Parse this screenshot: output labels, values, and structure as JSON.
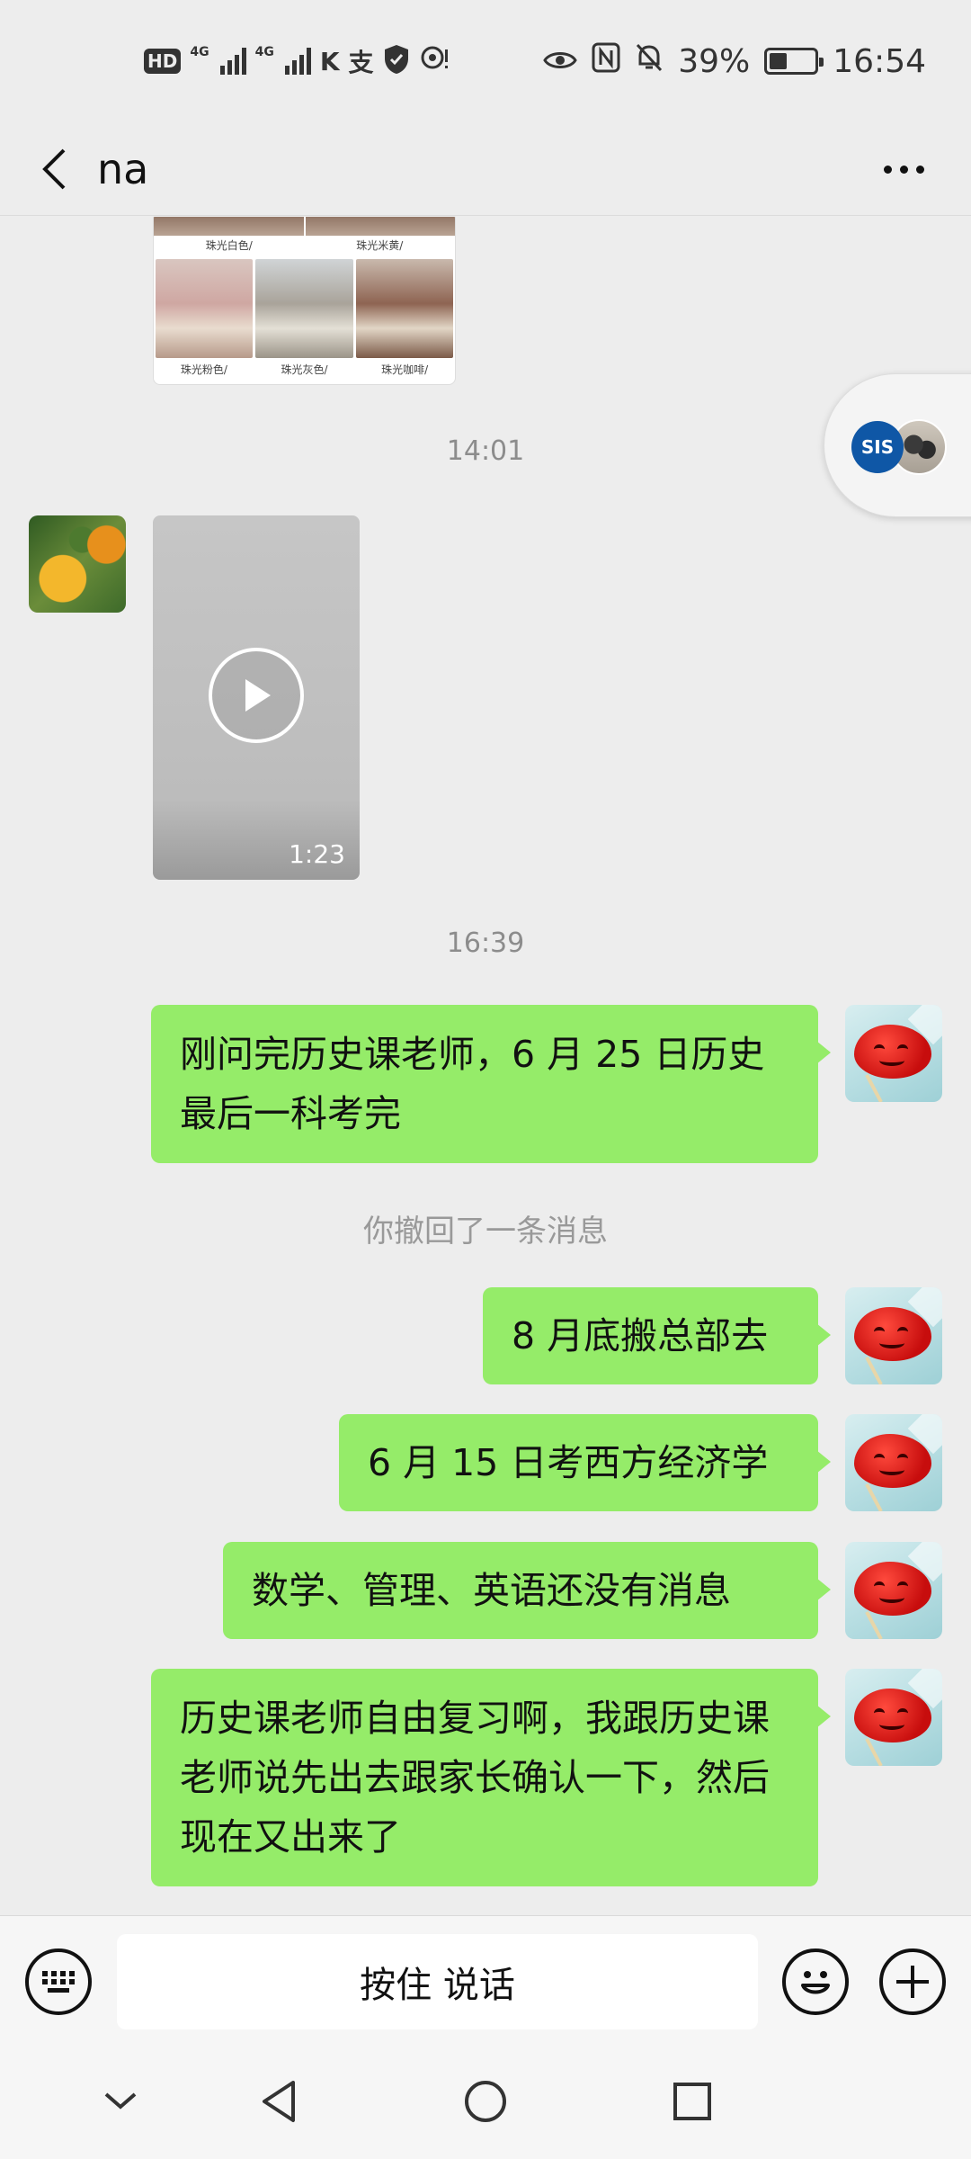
{
  "status_bar": {
    "hd_badge": "HD",
    "sim1_label": "4G",
    "sim2_label": "4G",
    "icons_left": [
      "hd-sim-icon",
      "signal-icon",
      "signal-icon",
      "k-app-icon",
      "alipay-icon",
      "shield-icon",
      "location-icon"
    ],
    "icons_right": [
      "eye-icon",
      "nfc-icon",
      "mute-icon"
    ],
    "battery_level": 0.39,
    "battery_text": "39%",
    "time": "16:54"
  },
  "header": {
    "title": "na"
  },
  "chat": {
    "product_image_labels_top": [
      "珠光白色/",
      "珠光米黄/"
    ],
    "product_image_labels_bottom": [
      "珠光粉色/",
      "珠光灰色/",
      "珠光咖啡/"
    ],
    "timestamp_1": "14:01",
    "video_duration": "1:23",
    "timestamp_2": "16:39",
    "messages": [
      {
        "sender": "me",
        "text": "刚问完历史课老师，6 月 25 日历史最后一科考完"
      },
      {
        "sender": "me",
        "text": "8 月底搬总部去"
      },
      {
        "sender": "me",
        "text": "6 月 15 日考西方经济学"
      },
      {
        "sender": "me",
        "text": "数学、管理、英语还没有消息"
      },
      {
        "sender": "me",
        "text": "历史课老师自由复习啊，我跟历史课老师说先出去跟家长确认一下，然后现在又出来了"
      }
    ],
    "recall_notice": "你撤回了一条消息"
  },
  "floating": {
    "avatar1_text": "SIS"
  },
  "input_bar": {
    "voice_button_label": "按住 说话"
  },
  "colors": {
    "bubble_green": "#95ec69",
    "background": "#ededed"
  }
}
